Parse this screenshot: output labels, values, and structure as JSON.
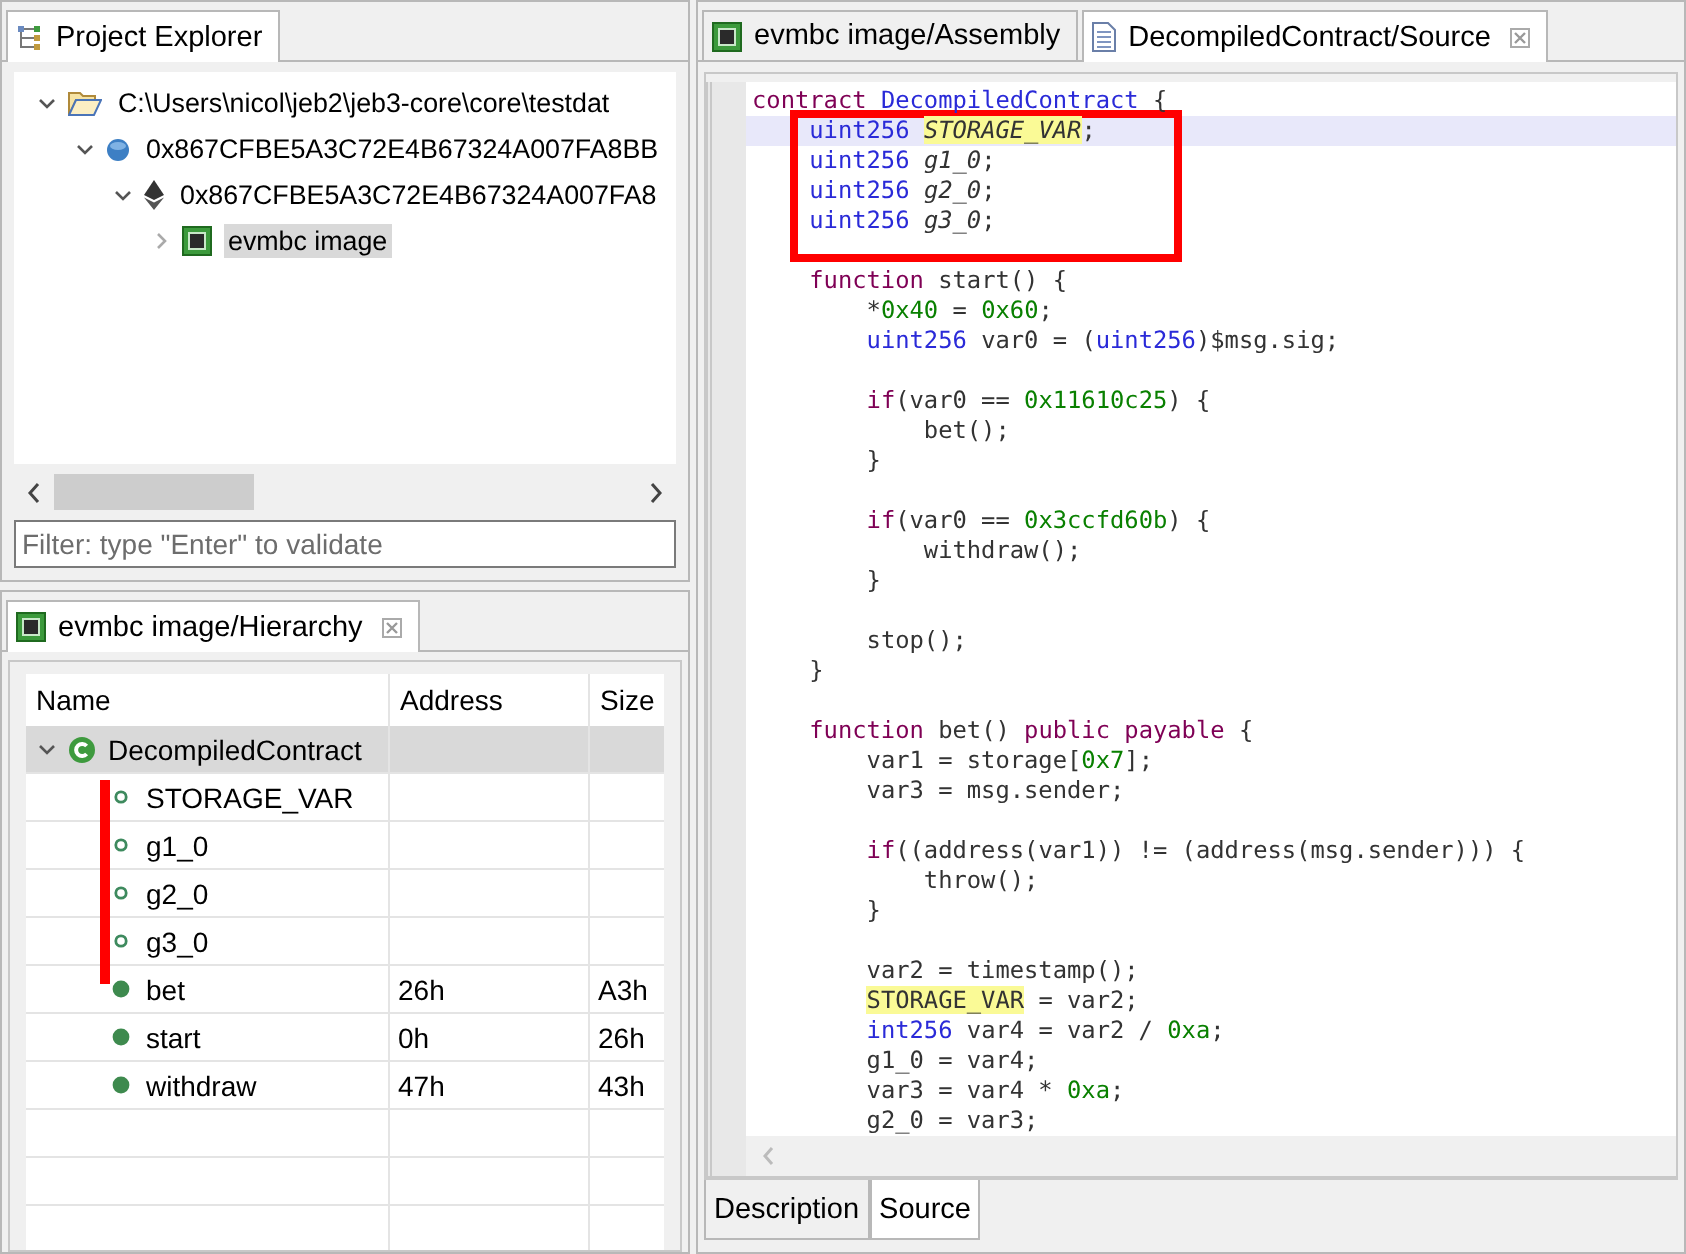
{
  "project_explorer": {
    "tab": {
      "label": "Project Explorer",
      "selected": true
    },
    "tree": [
      {
        "label": "C:\\Users\\nicol\\jeb2\\jeb3-core\\core\\testdat",
        "kind": "folder",
        "expanded": true,
        "selected": false,
        "children": [
          {
            "label": "0x867CFBE5A3C72E4B67324A007FA8BB",
            "kind": "blob",
            "expanded": true,
            "selected": false,
            "children": [
              {
                "label": "0x867CFBE5A3C72E4B67324A007FA8",
                "kind": "ether",
                "expanded": true,
                "selected": false,
                "children": [
                  {
                    "label": "evmbc image",
                    "kind": "chip",
                    "expanded": false,
                    "selected": true
                  }
                ]
              }
            ]
          }
        ]
      }
    ],
    "filter": {
      "placeholder": "Filter: type \"Enter\" to validate"
    }
  },
  "hierarchy": {
    "tab": {
      "label": "evmbc image/Hierarchy",
      "selected": true
    },
    "columns": [
      "Name",
      "Address",
      "Size"
    ],
    "rows": [
      {
        "name": "DecompiledContract",
        "kind": "class",
        "expanded": true,
        "selected": true,
        "children": [
          {
            "name": "STORAGE_VAR",
            "kind": "field",
            "selected": false
          },
          {
            "name": "g1_0",
            "kind": "field",
            "selected": false
          },
          {
            "name": "g2_0",
            "kind": "field",
            "selected": false
          },
          {
            "name": "g3_0",
            "kind": "field",
            "selected": false
          },
          {
            "name": "bet",
            "kind": "method",
            "address": "26h",
            "size": "A3h",
            "selected": false
          },
          {
            "name": "start",
            "kind": "method",
            "address": "0h",
            "size": "26h",
            "selected": false
          },
          {
            "name": "withdraw",
            "kind": "method",
            "address": "47h",
            "size": "43h",
            "selected": false
          }
        ]
      }
    ]
  },
  "editor": {
    "tabs": [
      {
        "label": "evmbc image/Assembly",
        "kind": "chip",
        "selected": false
      },
      {
        "label": "DecompiledContract/Source",
        "kind": "document",
        "selected": true
      }
    ],
    "lines": [
      {
        "kind": "code",
        "current": false,
        "tokens": [
          {
            "t": "contract",
            "kind": "keyword"
          },
          {
            "t": " DecompiledContract",
            "kind": "type"
          },
          {
            "t": " {",
            "kind": "plain"
          }
        ]
      },
      {
        "kind": "code",
        "current": true,
        "tokens": [
          {
            "t": "    uint256",
            "kind": "type"
          },
          {
            "t": " STORAGE_VAR",
            "kind": "field-highlight"
          },
          {
            "t": ";",
            "kind": "plain"
          }
        ]
      },
      {
        "kind": "code",
        "current": false,
        "tokens": [
          {
            "t": "    uint256",
            "kind": "type"
          },
          {
            "t": " g1_0",
            "kind": "field"
          },
          {
            "t": ";",
            "kind": "plain"
          }
        ]
      },
      {
        "kind": "code",
        "current": false,
        "tokens": [
          {
            "t": "    uint256",
            "kind": "type"
          },
          {
            "t": " g2_0",
            "kind": "field"
          },
          {
            "t": ";",
            "kind": "plain"
          }
        ]
      },
      {
        "kind": "code",
        "current": false,
        "tokens": [
          {
            "t": "    uint256",
            "kind": "type"
          },
          {
            "t": " g3_0",
            "kind": "field"
          },
          {
            "t": ";",
            "kind": "plain"
          }
        ]
      },
      {
        "kind": "blank"
      },
      {
        "kind": "code",
        "current": false,
        "tokens": [
          {
            "t": "    function",
            "kind": "keyword"
          },
          {
            "t": " start() {",
            "kind": "plain"
          }
        ]
      },
      {
        "kind": "code",
        "current": false,
        "tokens": [
          {
            "t": "        *",
            "kind": "plain"
          },
          {
            "t": "0x40",
            "kind": "number"
          },
          {
            "t": " = ",
            "kind": "plain"
          },
          {
            "t": "0x60",
            "kind": "number"
          },
          {
            "t": ";",
            "kind": "plain"
          }
        ]
      },
      {
        "kind": "code",
        "current": false,
        "tokens": [
          {
            "t": "        uint256",
            "kind": "type"
          },
          {
            "t": " var0 = (",
            "kind": "plain"
          },
          {
            "t": "uint256",
            "kind": "type"
          },
          {
            "t": ")$msg.sig;",
            "kind": "plain"
          }
        ]
      },
      {
        "kind": "blank"
      },
      {
        "kind": "code",
        "current": false,
        "tokens": [
          {
            "t": "        if",
            "kind": "keyword"
          },
          {
            "t": "(var0 == ",
            "kind": "plain"
          },
          {
            "t": "0x11610c25",
            "kind": "number"
          },
          {
            "t": ") {",
            "kind": "plain"
          }
        ]
      },
      {
        "kind": "code",
        "current": false,
        "tokens": [
          {
            "t": "            bet();",
            "kind": "plain"
          }
        ]
      },
      {
        "kind": "code",
        "current": false,
        "tokens": [
          {
            "t": "        }",
            "kind": "plain"
          }
        ]
      },
      {
        "kind": "blank"
      },
      {
        "kind": "code",
        "current": false,
        "tokens": [
          {
            "t": "        if",
            "kind": "keyword"
          },
          {
            "t": "(var0 == ",
            "kind": "plain"
          },
          {
            "t": "0x3ccfd60b",
            "kind": "number"
          },
          {
            "t": ") {",
            "kind": "plain"
          }
        ]
      },
      {
        "kind": "code",
        "current": false,
        "tokens": [
          {
            "t": "            withdraw();",
            "kind": "plain"
          }
        ]
      },
      {
        "kind": "code",
        "current": false,
        "tokens": [
          {
            "t": "        }",
            "kind": "plain"
          }
        ]
      },
      {
        "kind": "blank"
      },
      {
        "kind": "code",
        "current": false,
        "tokens": [
          {
            "t": "        stop();",
            "kind": "plain"
          }
        ]
      },
      {
        "kind": "code",
        "current": false,
        "tokens": [
          {
            "t": "    }",
            "kind": "plain"
          }
        ]
      },
      {
        "kind": "blank"
      },
      {
        "kind": "code",
        "current": false,
        "tokens": [
          {
            "t": "    function",
            "kind": "keyword"
          },
          {
            "t": " bet() ",
            "kind": "plain"
          },
          {
            "t": "public payable",
            "kind": "keyword"
          },
          {
            "t": " {",
            "kind": "plain"
          }
        ]
      },
      {
        "kind": "code",
        "current": false,
        "tokens": [
          {
            "t": "        var1 = storage[",
            "kind": "plain"
          },
          {
            "t": "0x7",
            "kind": "number"
          },
          {
            "t": "];",
            "kind": "plain"
          }
        ]
      },
      {
        "kind": "code",
        "current": false,
        "tokens": [
          {
            "t": "        var3 = msg.sender;",
            "kind": "plain"
          }
        ]
      },
      {
        "kind": "blank"
      },
      {
        "kind": "code",
        "current": false,
        "tokens": [
          {
            "t": "        if",
            "kind": "keyword"
          },
          {
            "t": "((address(var1)) != (address(msg.sender))) {",
            "kind": "plain"
          }
        ]
      },
      {
        "kind": "code",
        "current": false,
        "tokens": [
          {
            "t": "            throw();",
            "kind": "plain"
          }
        ]
      },
      {
        "kind": "code",
        "current": false,
        "tokens": [
          {
            "t": "        }",
            "kind": "plain"
          }
        ]
      },
      {
        "kind": "blank"
      },
      {
        "kind": "code",
        "current": false,
        "tokens": [
          {
            "t": "        var2 = timestamp();",
            "kind": "plain"
          }
        ]
      },
      {
        "kind": "code",
        "current": false,
        "tokens": [
          {
            "t": "        STORAGE_VAR",
            "kind": "highlight"
          },
          {
            "t": " = var2;",
            "kind": "plain"
          }
        ]
      },
      {
        "kind": "code",
        "current": false,
        "tokens": [
          {
            "t": "        int256",
            "kind": "type"
          },
          {
            "t": " var4 = var2 / ",
            "kind": "plain"
          },
          {
            "t": "0xa",
            "kind": "number"
          },
          {
            "t": ";",
            "kind": "plain"
          }
        ]
      },
      {
        "kind": "code",
        "current": false,
        "tokens": [
          {
            "t": "        g1_0 = var4;",
            "kind": "plain"
          }
        ]
      },
      {
        "kind": "code",
        "current": false,
        "tokens": [
          {
            "t": "        var3 = var4 * ",
            "kind": "plain"
          },
          {
            "t": "0xa",
            "kind": "number"
          },
          {
            "t": ";",
            "kind": "plain"
          }
        ]
      },
      {
        "kind": "code",
        "current": false,
        "tokens": [
          {
            "t": "        g2_0 = var3;",
            "kind": "plain"
          }
        ]
      }
    ],
    "bottom_tabs": [
      {
        "label": "Description",
        "selected": false
      },
      {
        "label": "Source",
        "selected": true
      }
    ]
  }
}
